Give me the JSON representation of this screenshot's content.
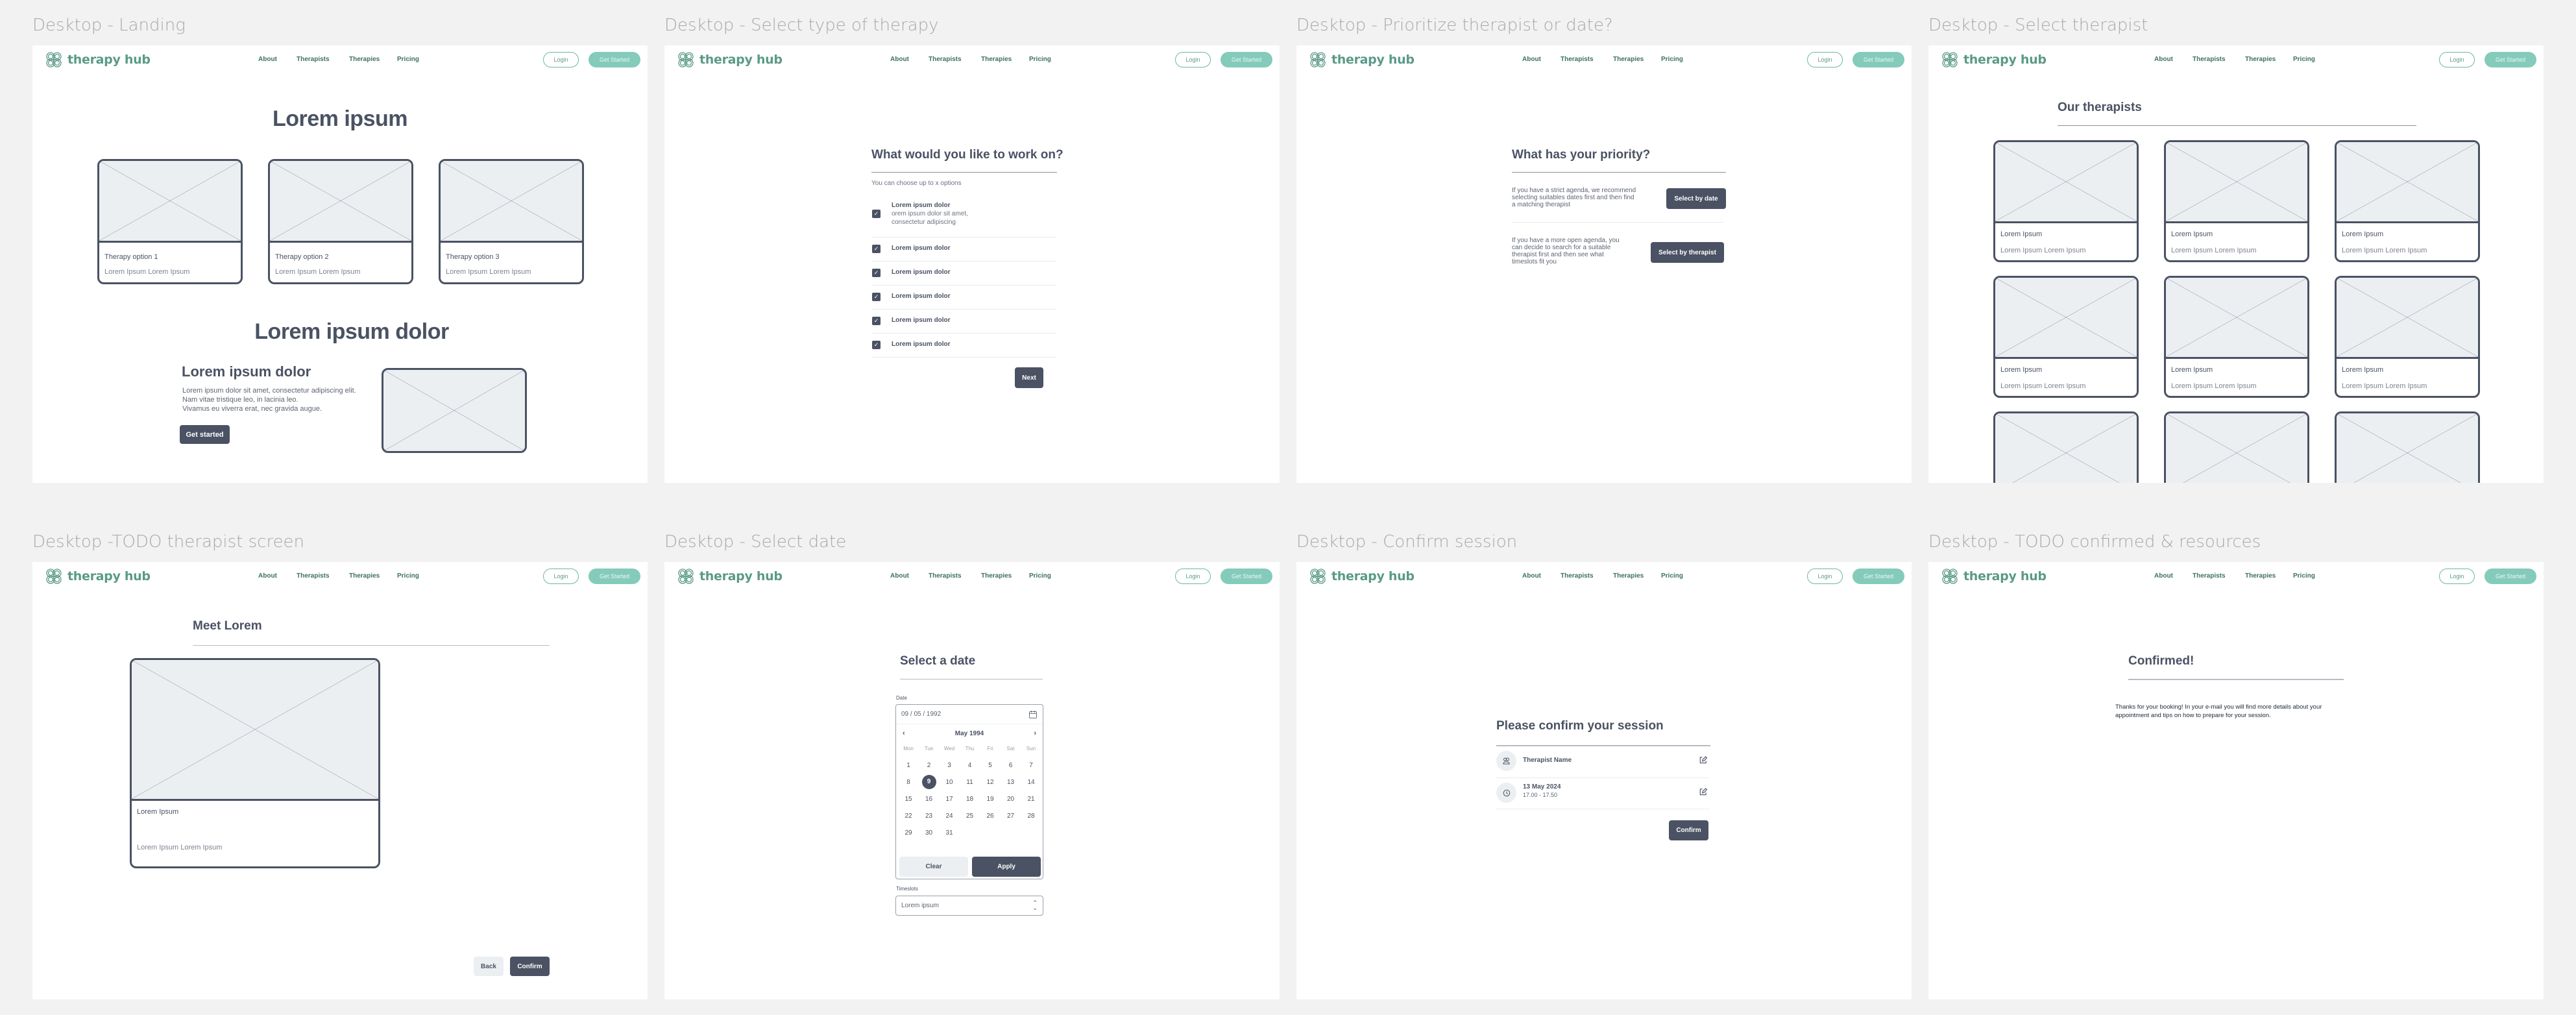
{
  "brand": {
    "name": "therapy hub",
    "accent": "#5b9a88",
    "button_accent": "#84cbbb",
    "dark": "#4a5263"
  },
  "nav": {
    "links": [
      "About",
      "Therapists",
      "Therapies",
      "Pricing"
    ],
    "login": "Login",
    "get_started": "Get Started"
  },
  "frames": {
    "landing": {
      "label": "Desktop - Landing",
      "hero_title": "Lorem ipsum",
      "cards": [
        {
          "title": "Therapy option 1",
          "subtitle": "Lorem Ipsum Lorem Ipsum"
        },
        {
          "title": "Therapy option 2",
          "subtitle": "Lorem Ipsum Lorem Ipsum"
        },
        {
          "title": "Therapy option 3",
          "subtitle": "Lorem Ipsum Lorem Ipsum"
        }
      ],
      "section_title": "Lorem ipsum dolor",
      "feature_title": "Lorem ipsum dolor",
      "feature_lines": [
        "Lorem ipsum dolor sit amet, consectetur adipiscing elit.",
        "Nam vitae tristique leo, in lacinia leo.",
        "Vivamus eu viverra erat, nec gravida augue."
      ],
      "cta": "Get started"
    },
    "therapy_type": {
      "label": "Desktop - Select type of therapy",
      "title": "What would you like to work on?",
      "hint": "You can choose up to x options",
      "options": [
        {
          "title": "Lorem ipsum dolor",
          "desc_lines": [
            "orem ipsum dolor sit amet,",
            "consectetur adipiscing"
          ],
          "checked": true
        },
        {
          "title": "Lorem ipsum dolor",
          "checked": true
        },
        {
          "title": "Lorem ipsum dolor",
          "checked": true
        },
        {
          "title": "Lorem ipsum dolor",
          "checked": true
        },
        {
          "title": "Lorem ipsum dolor",
          "checked": true
        },
        {
          "title": "Lorem ipsum dolor",
          "checked": true
        }
      ],
      "next": "Next"
    },
    "priority": {
      "label": "Desktop - Prioritize therapist or date?",
      "title": "What has your priority?",
      "choices": [
        {
          "text_lines": [
            "If you have a strict agenda, we recommend",
            "selecting suitables dates first and then find",
            "a matching therapist"
          ],
          "button": "Select by date"
        },
        {
          "text_lines": [
            "If you have a more open agenda, you",
            "can decide to search for a suitable",
            "therapist first and then see what",
            "timeslots fit you"
          ],
          "button": "Select by therapist"
        }
      ]
    },
    "select_therapist": {
      "label": "Desktop - Select therapist",
      "title": "Our therapists",
      "cards": [
        {
          "title": "Lorem Ipsum",
          "subtitle": "Lorem Ipsum Lorem Ipsum"
        },
        {
          "title": "Lorem Ipsum",
          "subtitle": "Lorem Ipsum Lorem Ipsum"
        },
        {
          "title": "Lorem Ipsum",
          "subtitle": "Lorem Ipsum Lorem Ipsum"
        },
        {
          "title": "Lorem Ipsum",
          "subtitle": "Lorem Ipsum Lorem Ipsum"
        },
        {
          "title": "Lorem Ipsum",
          "subtitle": "Lorem Ipsum Lorem Ipsum"
        },
        {
          "title": "Lorem Ipsum",
          "subtitle": "Lorem Ipsum Lorem Ipsum"
        },
        {
          "title": "",
          "subtitle": ""
        },
        {
          "title": "",
          "subtitle": ""
        },
        {
          "title": "",
          "subtitle": ""
        }
      ]
    },
    "therapist_screen": {
      "label": "Desktop -TODO therapist screen",
      "title": "Meet Lorem",
      "card_title": "Lorem Ipsum",
      "card_subtitle": "Lorem Ipsum Lorem Ipsum",
      "back": "Back",
      "confirm": "Confirm"
    },
    "select_date": {
      "label": "Desktop - Select date",
      "title": "Select a date",
      "date_label": "Date",
      "date_value": "09 / 05 / 1992",
      "month": "May 1994",
      "weekdays": [
        "Mon",
        "Tue",
        "Wed",
        "Thu",
        "Fri",
        "Sat",
        "Sun"
      ],
      "days": [
        "1",
        "2",
        "3",
        "4",
        "5",
        "6",
        "7",
        "8",
        "9",
        "10",
        "11",
        "12",
        "13",
        "14",
        "15",
        "16",
        "17",
        "18",
        "19",
        "20",
        "21",
        "22",
        "23",
        "24",
        "25",
        "26",
        "27",
        "28",
        "29",
        "30",
        "31"
      ],
      "selected_day": "9",
      "clear": "Clear",
      "apply": "Apply",
      "timeslots_label": "Timeslots",
      "timeslot_value": "Lorem ipsum"
    },
    "confirm_session": {
      "label": "Desktop - Confirm session",
      "title": "Please confirm your session",
      "therapist": "Therapist Name",
      "date": "13 May 2024",
      "time": "17.00 - 17.50",
      "confirm": "Confirm"
    },
    "confirmed": {
      "label": "Desktop - TODO confirmed & resources",
      "title": "Confirmed!",
      "message_lines": [
        "Thanks for your booking! In your e-mail you will find more details about your",
        "appointment and tips on how to prepare for your session."
      ]
    }
  }
}
